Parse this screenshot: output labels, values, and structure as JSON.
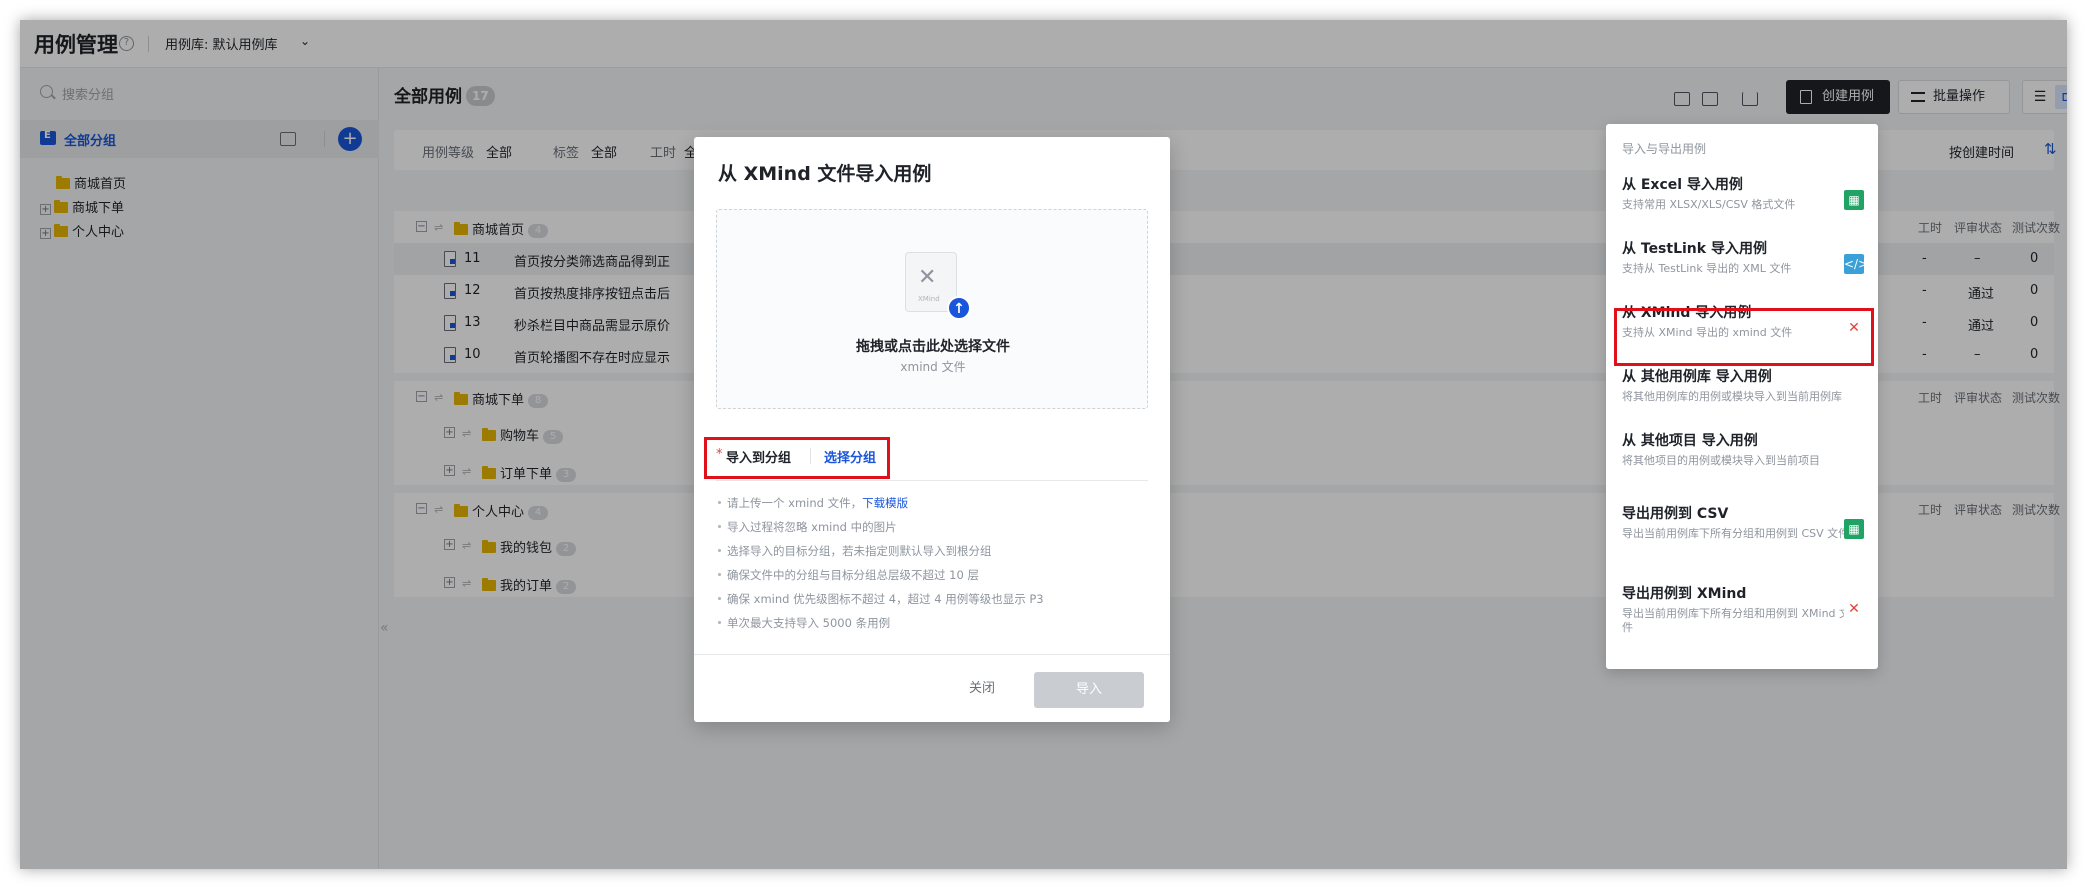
{
  "header": {
    "title": "用例管理",
    "library_label": "用例库: 默认用例库"
  },
  "sidebar": {
    "search_placeholder": "搜索分组",
    "all_groups": "全部分组",
    "items": [
      {
        "label": "商城首页",
        "expandable": false
      },
      {
        "label": "商城下单",
        "expandable": true
      },
      {
        "label": "个人中心",
        "expandable": true
      }
    ]
  },
  "main": {
    "title": "全部用例",
    "count": "17",
    "create_button": "创建用例",
    "batch_button": "批量操作",
    "filters": [
      {
        "label": "用例等级",
        "value": "全部"
      },
      {
        "label": "标签",
        "value": "全部"
      },
      {
        "label": "工时",
        "value": "全"
      }
    ],
    "sort_label": "按创建时间",
    "columns": {
      "hours": "工时",
      "review": "评审状态",
      "tests": "测试次数"
    },
    "groups": [
      {
        "name": "商城首页",
        "count": "4",
        "rows": [
          {
            "id": "11",
            "title": "首页按分类筛选商品得到正",
            "hours": "-",
            "review": "–",
            "tests": "0"
          },
          {
            "id": "12",
            "title": "首页按热度排序按钮点击后",
            "hours": "-",
            "review": "通过",
            "tests": "0"
          },
          {
            "id": "13",
            "title": "秒杀栏目中商品需显示原价",
            "hours": "-",
            "review": "通过",
            "tests": "0"
          },
          {
            "id": "10",
            "title": "首页轮播图不存在时应显示",
            "hours": "-",
            "review": "–",
            "tests": "0"
          }
        ]
      },
      {
        "name": "商城下单",
        "count": "8",
        "subgroups": [
          {
            "name": "购物车",
            "count": "5"
          },
          {
            "name": "订单下单",
            "count": "3"
          }
        ]
      },
      {
        "name": "个人中心",
        "count": "4",
        "subgroups": [
          {
            "name": "我的钱包",
            "count": "2"
          },
          {
            "name": "我的订单",
            "count": "2"
          }
        ]
      }
    ]
  },
  "dropdown": {
    "header": "导入与导出用例",
    "items": [
      {
        "title": "从 Excel 导入用例",
        "desc": "支持常用 XLSX/XLS/CSV 格式文件",
        "icon": "excel-icon"
      },
      {
        "title": "从 TestLink 导入用例",
        "desc": "支持从 TestLink 导出的 XML 文件",
        "icon": "code-icon"
      },
      {
        "title": "从 XMind 导入用例",
        "desc": "支持从 XMind 导出的 xmind 文件",
        "icon": "xmind-icon"
      },
      {
        "title": "从 其他用例库 导入用例",
        "desc": "将其他用例库的用例或模块导入到当前用例库",
        "icon": ""
      },
      {
        "title": "从 其他项目 导入用例",
        "desc": "将其他项目的用例或模块导入到当前项目",
        "icon": ""
      },
      {
        "title": "导出用例到 CSV",
        "desc": "导出当前用例库下所有分组和用例到 CSV 文件",
        "icon": "excel-icon"
      },
      {
        "title": "导出用例到 XMind",
        "desc": "导出当前用例库下所有分组和用例到 XMind 文件",
        "icon": "xmind-icon"
      }
    ]
  },
  "modal": {
    "title": "从 XMind 文件导入用例",
    "dropzone_main": "拖拽或点击此处选择文件",
    "dropzone_sub": "xmind 文件",
    "file_icon_text": "XMind",
    "field_required": "*",
    "field_label": "导入到分组",
    "field_link": "选择分组",
    "notes": [
      {
        "text": "请上传一个 xmind 文件，",
        "link": "下载模版"
      },
      {
        "text": "导入过程将忽略 xmind 中的图片"
      },
      {
        "text": "选择导入的目标分组，若未指定则默认导入到根分组"
      },
      {
        "text": "确保文件中的分组与目标分组总层级不超过 10 层"
      },
      {
        "text": "确保 xmind 优先级图标不超过 4，超过 4 用例等级也显示 P3"
      },
      {
        "text": "单次最大支持导入 5000 条用例"
      }
    ],
    "close_button": "关闭",
    "import_button": "导入"
  },
  "colors": {
    "accent": "#1a56db",
    "highlight": "#e0101a",
    "dark_button": "#1f2329"
  }
}
